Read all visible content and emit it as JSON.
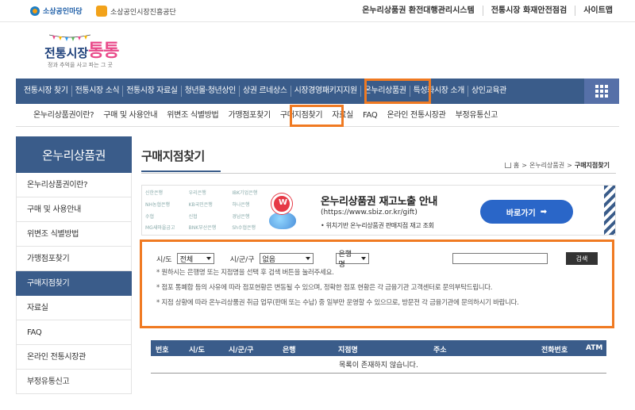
{
  "top": {
    "sosang_logo": "소상공인마당",
    "agency_logo": "소상공인시장진흥공단",
    "links": [
      "온누리상품권 환전대행관리시스템",
      "전통시장 화재안전점검",
      "사이트맵"
    ]
  },
  "brand": {
    "name_left": "전통시장",
    "name_right": "통통",
    "slogan": "정과 추억을 사고 파는 그 곳"
  },
  "main_nav": [
    "전통시장 찾기",
    "전통시장 소식",
    "전통시장 자료실",
    "청년몰·청년상인",
    "상권 르네상스",
    "시장경영패키지지원",
    "온누리상품권",
    "특성화시장 소개",
    "상인교육관"
  ],
  "sub_nav": [
    "온누리상품권이란?",
    "구매 및 사용안내",
    "위변조 식별방법",
    "가맹점포찾기",
    "구매지점찾기",
    "자료실",
    "FAQ",
    "온라인 전통시장관",
    "부정유통신고"
  ],
  "sidebar": {
    "title": "온누리상품권",
    "items": [
      "온누리상품권이란?",
      "구매 및 사용안내",
      "위변조 식별방법",
      "가맹점포찾기",
      "구매지점찾기",
      "자료실",
      "FAQ",
      "온라인 전통시장관",
      "부정유통신고"
    ]
  },
  "page": {
    "title": "구매지점찾기",
    "breadcrumb": [
      "홈",
      "온누리상품권",
      "구매지점찾기"
    ]
  },
  "banner": {
    "bank_logos": [
      "신한은행",
      "우리은행",
      "IBK기업은행",
      "NH농협은행",
      "KB국민은행",
      "하나은행",
      "수협",
      "신협",
      "경남은행",
      "MG새마을금고",
      "BNK부산은행",
      "Sh수협은행"
    ],
    "title": "온누리상품권 재고노출 안내",
    "url": "(https://www.sbiz.or.kr/gift)",
    "desc": "• 위치기반 온누리상품권 판매지점 재고 조회",
    "button": "바로가기"
  },
  "search": {
    "sido_label": "시/도",
    "sido_value": "전체",
    "sigungu_label": "시/군/구",
    "sigungu_value": "없음",
    "bank_value": "은행명",
    "button": "검색",
    "notes": [
      "* 원하시는 은행명 또는 지점명을 선택 후 검색 버튼을 눌러주세요.",
      "* 점포 통폐합 등의 사유에 따라 점포현황은 변동될 수 있으며, 정확한 점포 현황은 각 금융기관 고객센터로 문의부탁드립니다.",
      "* 지점 상황에 따라 온누리상품권 취급 업무(판매 또는 수납) 중 일부만 운영할 수 있으므로, 방문전 각 금융기관에 문의하시기 바랍니다."
    ]
  },
  "table": {
    "headers": [
      "번호",
      "시/도",
      "시/군/구",
      "은행",
      "지점명",
      "주소",
      "전화번호",
      "ATM"
    ],
    "empty": "목록이 존재하지 않습니다."
  }
}
